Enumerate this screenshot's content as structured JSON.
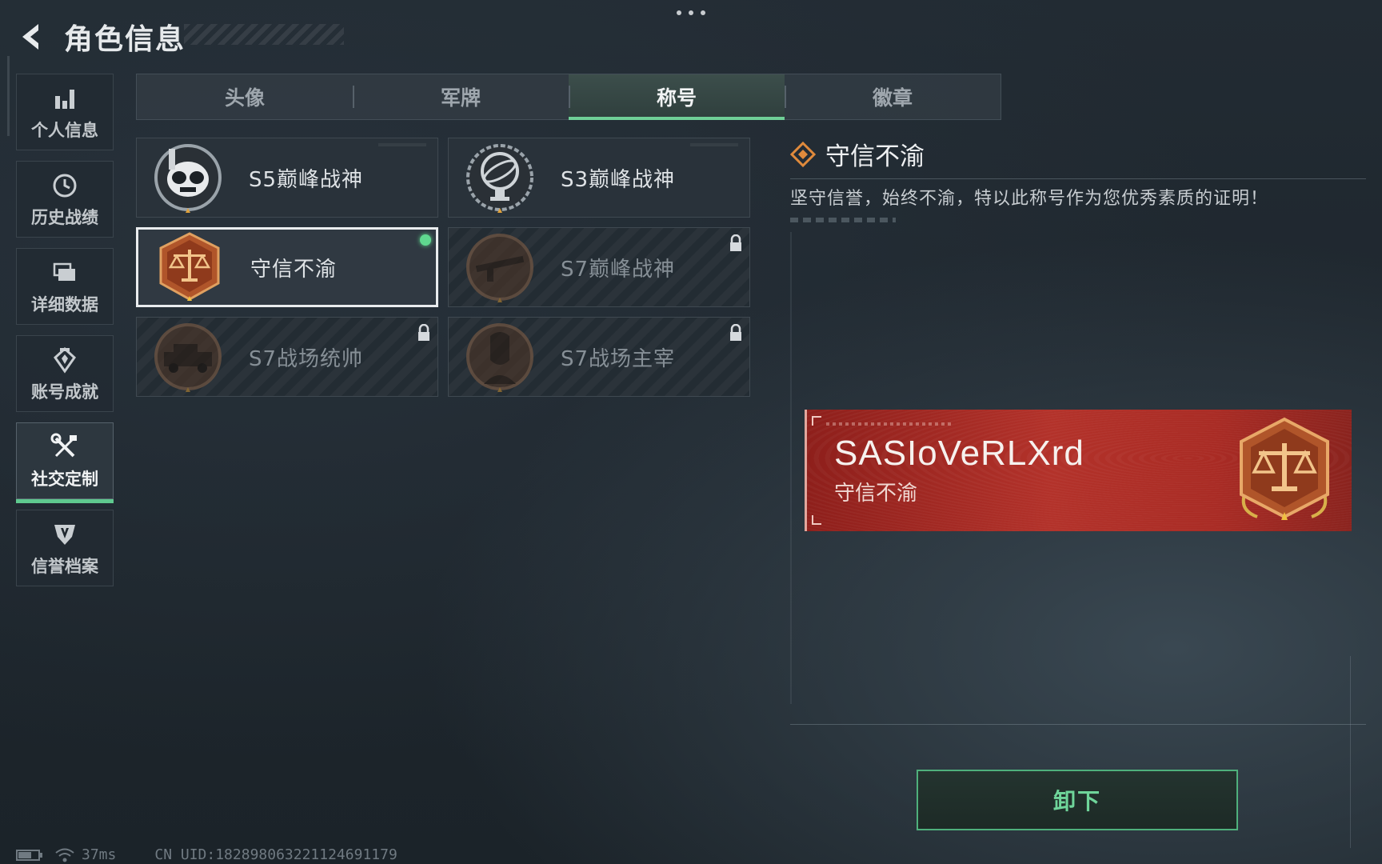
{
  "header": {
    "title": "角色信息"
  },
  "sidebar": {
    "items": [
      {
        "label": "个人信息",
        "icon": "bar-chart-icon",
        "active": false
      },
      {
        "label": "历史战绩",
        "icon": "history-clock-icon",
        "active": false
      },
      {
        "label": "详细数据",
        "icon": "folder-stack-icon",
        "active": false
      },
      {
        "label": "账号成就",
        "icon": "medal-icon",
        "active": false
      },
      {
        "label": "社交定制",
        "icon": "tools-icon",
        "active": true
      },
      {
        "label": "信誉档案",
        "icon": "shield-emblem-icon",
        "active": false
      }
    ]
  },
  "tabs": [
    {
      "label": "头像",
      "active": false
    },
    {
      "label": "军牌",
      "active": false
    },
    {
      "label": "称号",
      "active": true
    },
    {
      "label": "徽章",
      "active": false
    }
  ],
  "titles": [
    {
      "name": "S5巅峰战神",
      "badge": "skull-mask-badge",
      "locked": false,
      "selected": false
    },
    {
      "name": "S3巅峰战神",
      "badge": "globe-trophy-badge",
      "locked": false,
      "selected": false
    },
    {
      "name": "守信不渝",
      "badge": "scales-badge",
      "locked": false,
      "selected": true,
      "equipped": true
    },
    {
      "name": "S7巅峰战神",
      "badge": "rifle-badge",
      "locked": true,
      "selected": false
    },
    {
      "name": "S7战场统帅",
      "badge": "vehicle-badge",
      "locked": true,
      "selected": false
    },
    {
      "name": "S7战场主宰",
      "badge": "soldier-portrait-badge",
      "locked": true,
      "selected": false
    }
  ],
  "detail": {
    "title": "守信不渝",
    "description": "坚守信誉，始终不渝，特以此称号作为您优秀素质的证明！"
  },
  "preview": {
    "player_name": "SASIoVeRLXrd",
    "title": "守信不渝"
  },
  "actions": {
    "unequip_label": "卸下"
  },
  "status": {
    "ping": "37ms",
    "uid": "CN UID:1828980632211246911​79"
  },
  "colors": {
    "accent_green": "#6fcf97",
    "plate_red": "#b3322a",
    "badge_orange": "#c8652c"
  }
}
